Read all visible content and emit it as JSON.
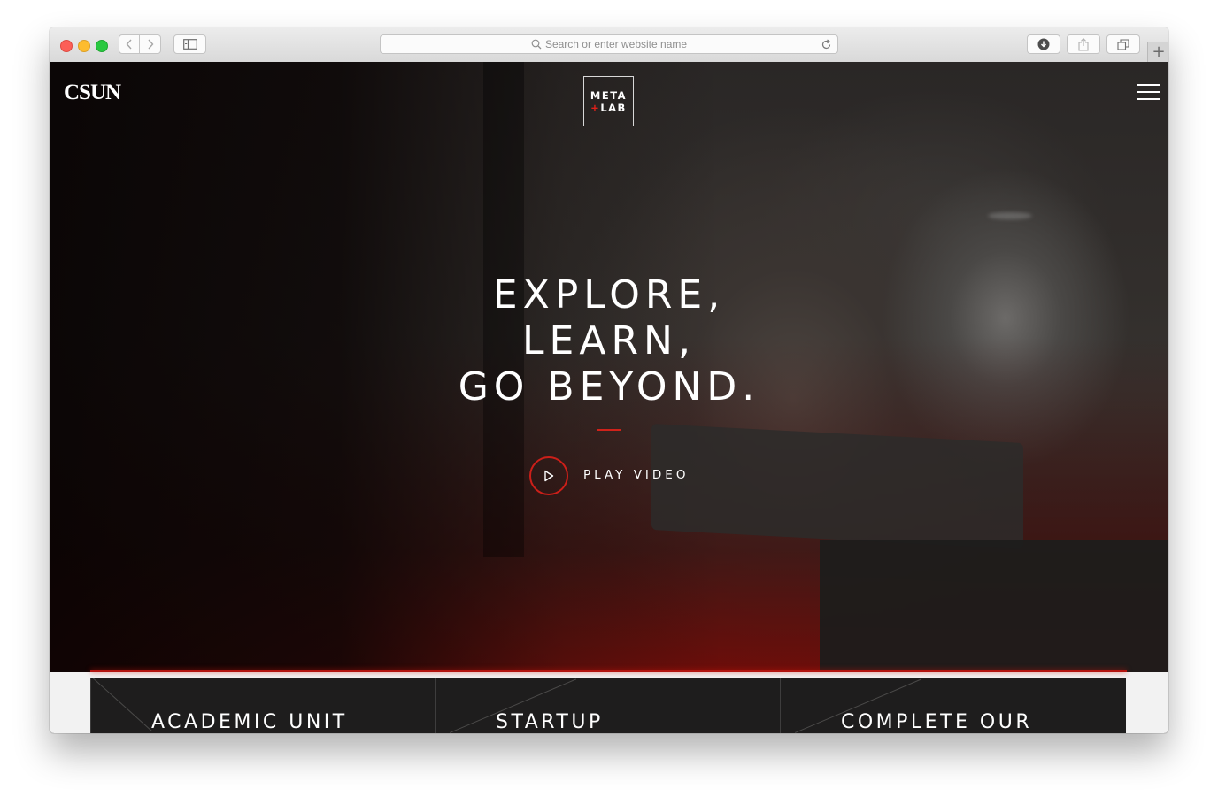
{
  "browser": {
    "address_placeholder": "Search or enter website name",
    "icons": {
      "back": "chevron-left-icon",
      "forward": "chevron-right-icon",
      "sidebar": "sidebar-icon",
      "search": "search-icon",
      "reload": "reload-icon",
      "download": "download-icon",
      "share": "share-icon",
      "tabs": "tabs-icon",
      "new_tab": "plus-icon"
    },
    "new_tab_glyph": "+"
  },
  "header": {
    "logo": "CSUN",
    "metalab_top": "META",
    "metalab_plus": "+",
    "metalab_bottom": "LAB",
    "menu_icon": "hamburger-icon"
  },
  "hero": {
    "headline": [
      "EXPLORE,",
      "LEARN,",
      "GO BEYOND."
    ],
    "play_label": "PLAY VIDEO",
    "play_icon": "play-icon"
  },
  "cards": [
    {
      "title": "ACADEMIC UNIT"
    },
    {
      "title": "STARTUP"
    },
    {
      "title": "COMPLETE OUR"
    }
  ],
  "colors": {
    "accent_red": "#d0221a",
    "card_bg": "#1e1d1d",
    "text": "#ffffff"
  }
}
